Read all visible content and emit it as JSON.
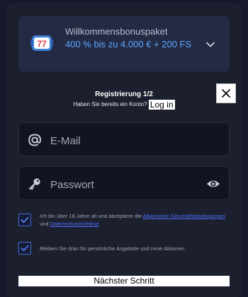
{
  "bonus": {
    "title": "Willkommensbonuspaket",
    "offer": "400 % bis zu 4.000 € + 200 FS",
    "icon": "slot-777-icon"
  },
  "registration": {
    "step": "Registrierung 1/2",
    "has_account": "Haben Sie bereits ein Konto?",
    "login_label": "Log in"
  },
  "form": {
    "email_placeholder": "E-Mail",
    "password_placeholder": "Passwort"
  },
  "consent": {
    "terms_text_before": "Ich bin über 18 Jahre alt und akzeptiere die ",
    "terms_link": "Allgemeine Geschäftsbedingungen",
    "terms_text_mid": " und ",
    "privacy_link": "Datenschutzrichtlinie",
    "terms_checked": true,
    "promo_text": "Bleiben Sie dran für persönliche Angebote und neue Aktionen",
    "promo_checked": true
  },
  "actions": {
    "next_label": "Nächster Schritt",
    "close_icon": "close-icon"
  },
  "colors": {
    "background": "#16192a",
    "bonus_card": "#252a44",
    "accent_blue": "#5aa8ff",
    "link_blue": "#4f6fff"
  }
}
